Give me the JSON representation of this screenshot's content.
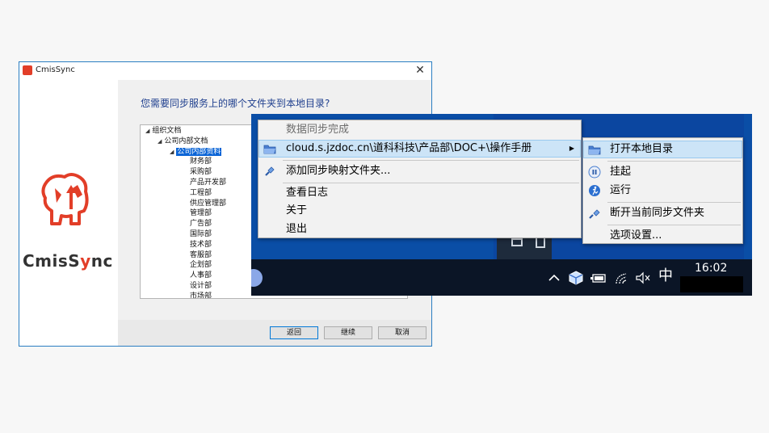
{
  "window": {
    "title": "CmisSync",
    "close_glyph": "✕",
    "logo_text_pre": "CmisS",
    "logo_text_y": "y",
    "logo_text_post": "nc",
    "question": "您需要同步服务上的哪个文件夹到本地目录?",
    "tree": [
      {
        "label": "组织文档",
        "level": 0,
        "expanded": true
      },
      {
        "label": "公司内部文档",
        "level": 1,
        "expanded": true
      },
      {
        "label": "公司内部资料",
        "level": 2,
        "expanded": true,
        "selected": true
      },
      {
        "label": "财务部",
        "level": 3
      },
      {
        "label": "采购部",
        "level": 3
      },
      {
        "label": "产品开发部",
        "level": 3
      },
      {
        "label": "工程部",
        "level": 3
      },
      {
        "label": "供应管理部",
        "level": 3
      },
      {
        "label": "管理部",
        "level": 3
      },
      {
        "label": "广告部",
        "level": 3
      },
      {
        "label": "国际部",
        "level": 3
      },
      {
        "label": "技术部",
        "level": 3
      },
      {
        "label": "客服部",
        "level": 3
      },
      {
        "label": "企划部",
        "level": 3
      },
      {
        "label": "人事部",
        "level": 3
      },
      {
        "label": "设计部",
        "level": 3
      },
      {
        "label": "市场部",
        "level": 3
      }
    ],
    "buttons": {
      "back": "返回",
      "continue": "继续",
      "cancel": "取消"
    },
    "colors": {
      "brand": "#e23e28",
      "accent": "#0078d7",
      "question": "#1f3f8e"
    }
  },
  "context_menu": {
    "items": [
      {
        "label": "数据同步完成",
        "disabled": true,
        "icon": ""
      },
      {
        "label": "cloud.s.jzdoc.cn\\道科科技\\产品部\\DOC+\\操作手册",
        "highlighted": true,
        "submenu": true,
        "icon": "folder-icon"
      },
      {
        "label": "添加同步映射文件夹...",
        "icon": "plug-icon"
      },
      {
        "label": "查看日志",
        "icon": ""
      },
      {
        "label": "关于",
        "icon": ""
      },
      {
        "label": "退出",
        "icon": ""
      }
    ],
    "submenu_arrow": "▶"
  },
  "submenu": {
    "items": [
      {
        "label": "打开本地目录",
        "highlighted": true,
        "icon": "folder-open-icon"
      },
      {
        "label": "挂起",
        "icon": "pause-icon"
      },
      {
        "label": "运行",
        "icon": "run-icon"
      },
      {
        "label": "断开当前同步文件夹",
        "icon": "unplug-icon"
      },
      {
        "label": "选项设置...",
        "icon": ""
      }
    ]
  },
  "taskbar": {
    "clock": "16:02",
    "ime": "中",
    "tray_icons": [
      "chevron-up-icon",
      "cloud-sync-icon",
      "battery-icon",
      "wifi-icon",
      "volume-muted-icon"
    ]
  }
}
